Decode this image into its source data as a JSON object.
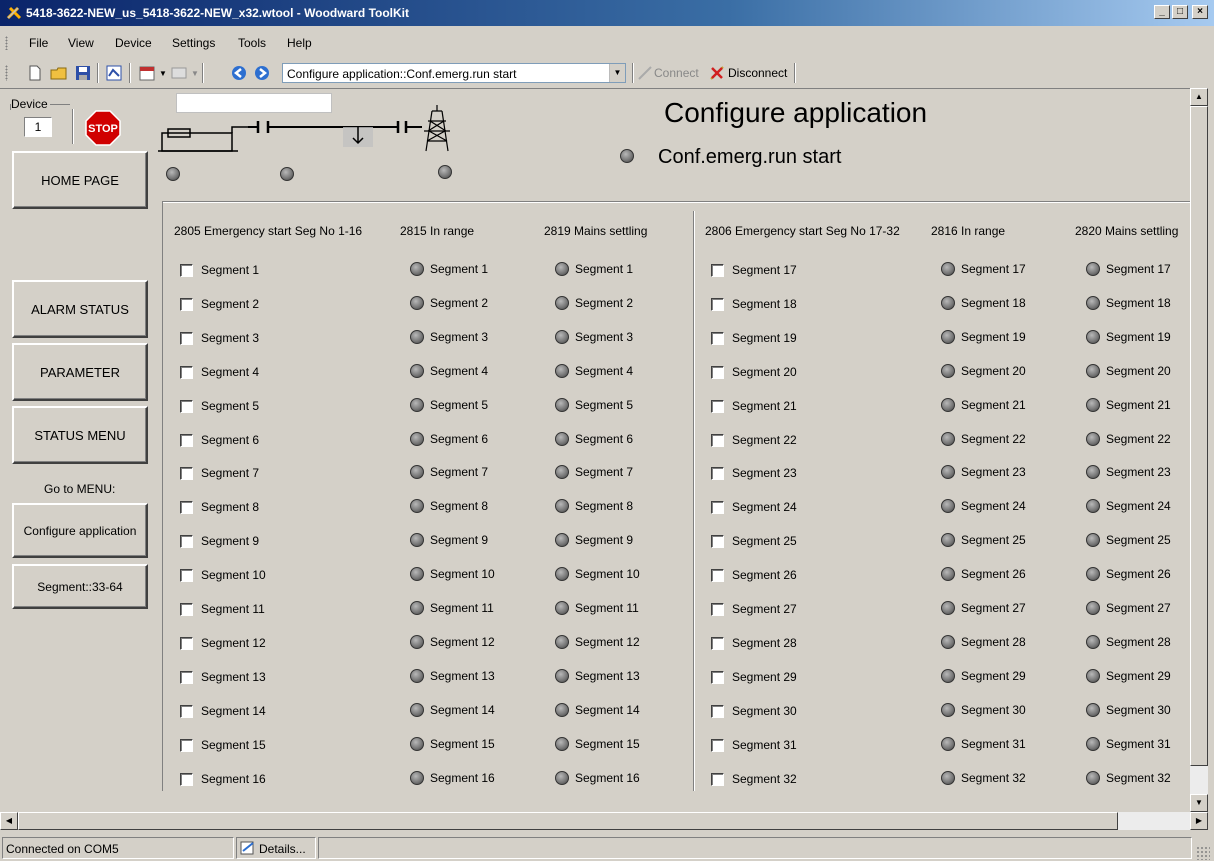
{
  "window": {
    "title": "5418-3622-NEW_us_5418-3622-NEW_x32.wtool - Woodward ToolKit",
    "minimize": "_",
    "maximize": "□",
    "close": "×"
  },
  "menu": [
    "File",
    "View",
    "Device",
    "Settings",
    "Tools",
    "Help"
  ],
  "toolbar": {
    "combo_value": "Configure application::Conf.emerg.run start",
    "connect_label": "Connect",
    "disconnect_label": "Disconnect"
  },
  "device": {
    "label": "Device",
    "number": "1",
    "stop_label": "STOP"
  },
  "nav": {
    "home": "HOME PAGE",
    "alarm": "ALARM STATUS",
    "parameter": "PARAMETER",
    "status_menu": "STATUS MENU",
    "goto_label": "Go to MENU:",
    "configure": "Configure application",
    "segment": "Segment::33-64"
  },
  "header": {
    "title": "Configure application",
    "subtitle": "Conf.emerg.run start"
  },
  "left_group": {
    "col1": "2805 Emergency start Seg No 1-16",
    "col2": "2815 In range",
    "col3": "2819 Mains settling",
    "rows": [
      "Segment 1",
      "Segment 2",
      "Segment 3",
      "Segment 4",
      "Segment 5",
      "Segment 6",
      "Segment 7",
      "Segment 8",
      "Segment 9",
      "Segment 10",
      "Segment 11",
      "Segment 12",
      "Segment 13",
      "Segment 14",
      "Segment 15",
      "Segment 16"
    ]
  },
  "right_group": {
    "col1": "2806 Emergency start Seg No 17-32",
    "col2": "2816 In range",
    "col3": "2820 Mains settling",
    "rows": [
      "Segment 17",
      "Segment 18",
      "Segment 19",
      "Segment 20",
      "Segment 21",
      "Segment 22",
      "Segment 23",
      "Segment 24",
      "Segment 25",
      "Segment 26",
      "Segment 27",
      "Segment 28",
      "Segment 29",
      "Segment 30",
      "Segment 31",
      "Segment 32"
    ]
  },
  "status": {
    "connection": "Connected on COM5",
    "details": "Details..."
  }
}
